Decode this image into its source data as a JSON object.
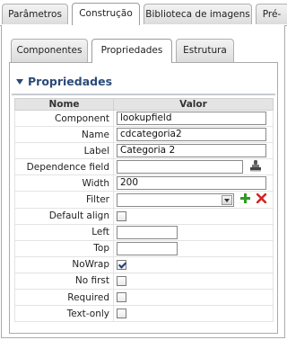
{
  "outer_tabs": [
    "Parâmetros",
    "Construção",
    "Biblioteca de imagens",
    "Pré-"
  ],
  "inner_tabs": [
    "Componentes",
    "Propriedades",
    "Estrutura"
  ],
  "section": {
    "title": "Propriedades"
  },
  "table": {
    "headers": {
      "name": "Nome",
      "value": "Valor"
    },
    "rows": [
      {
        "label": "Component",
        "type": "text",
        "value": "lookupfield"
      },
      {
        "label": "Name",
        "type": "text",
        "value": "cdcategoria2"
      },
      {
        "label": "Label",
        "type": "text",
        "value": "Categoria 2"
      },
      {
        "label": "Dependence field",
        "type": "text-icon",
        "value": ""
      },
      {
        "label": "Width",
        "type": "text",
        "value": "200"
      },
      {
        "label": "Filter",
        "type": "select",
        "value": ""
      },
      {
        "label": "Default align",
        "type": "checkbox",
        "checked": false
      },
      {
        "label": "Left",
        "type": "short",
        "value": ""
      },
      {
        "label": "Top",
        "type": "short",
        "value": ""
      },
      {
        "label": "NoWrap",
        "type": "checkbox",
        "checked": true
      },
      {
        "label": "No first",
        "type": "checkbox",
        "checked": false
      },
      {
        "label": "Required",
        "type": "checkbox",
        "checked": false
      },
      {
        "label": "Text-only",
        "type": "checkbox",
        "checked": false
      }
    ]
  },
  "icons": {
    "dependence": "stamp-icon",
    "add": "add-icon",
    "remove": "remove-icon"
  },
  "colors": {
    "header_text": "#2b4a7a",
    "add": "#2e9b22",
    "remove": "#d52323"
  }
}
